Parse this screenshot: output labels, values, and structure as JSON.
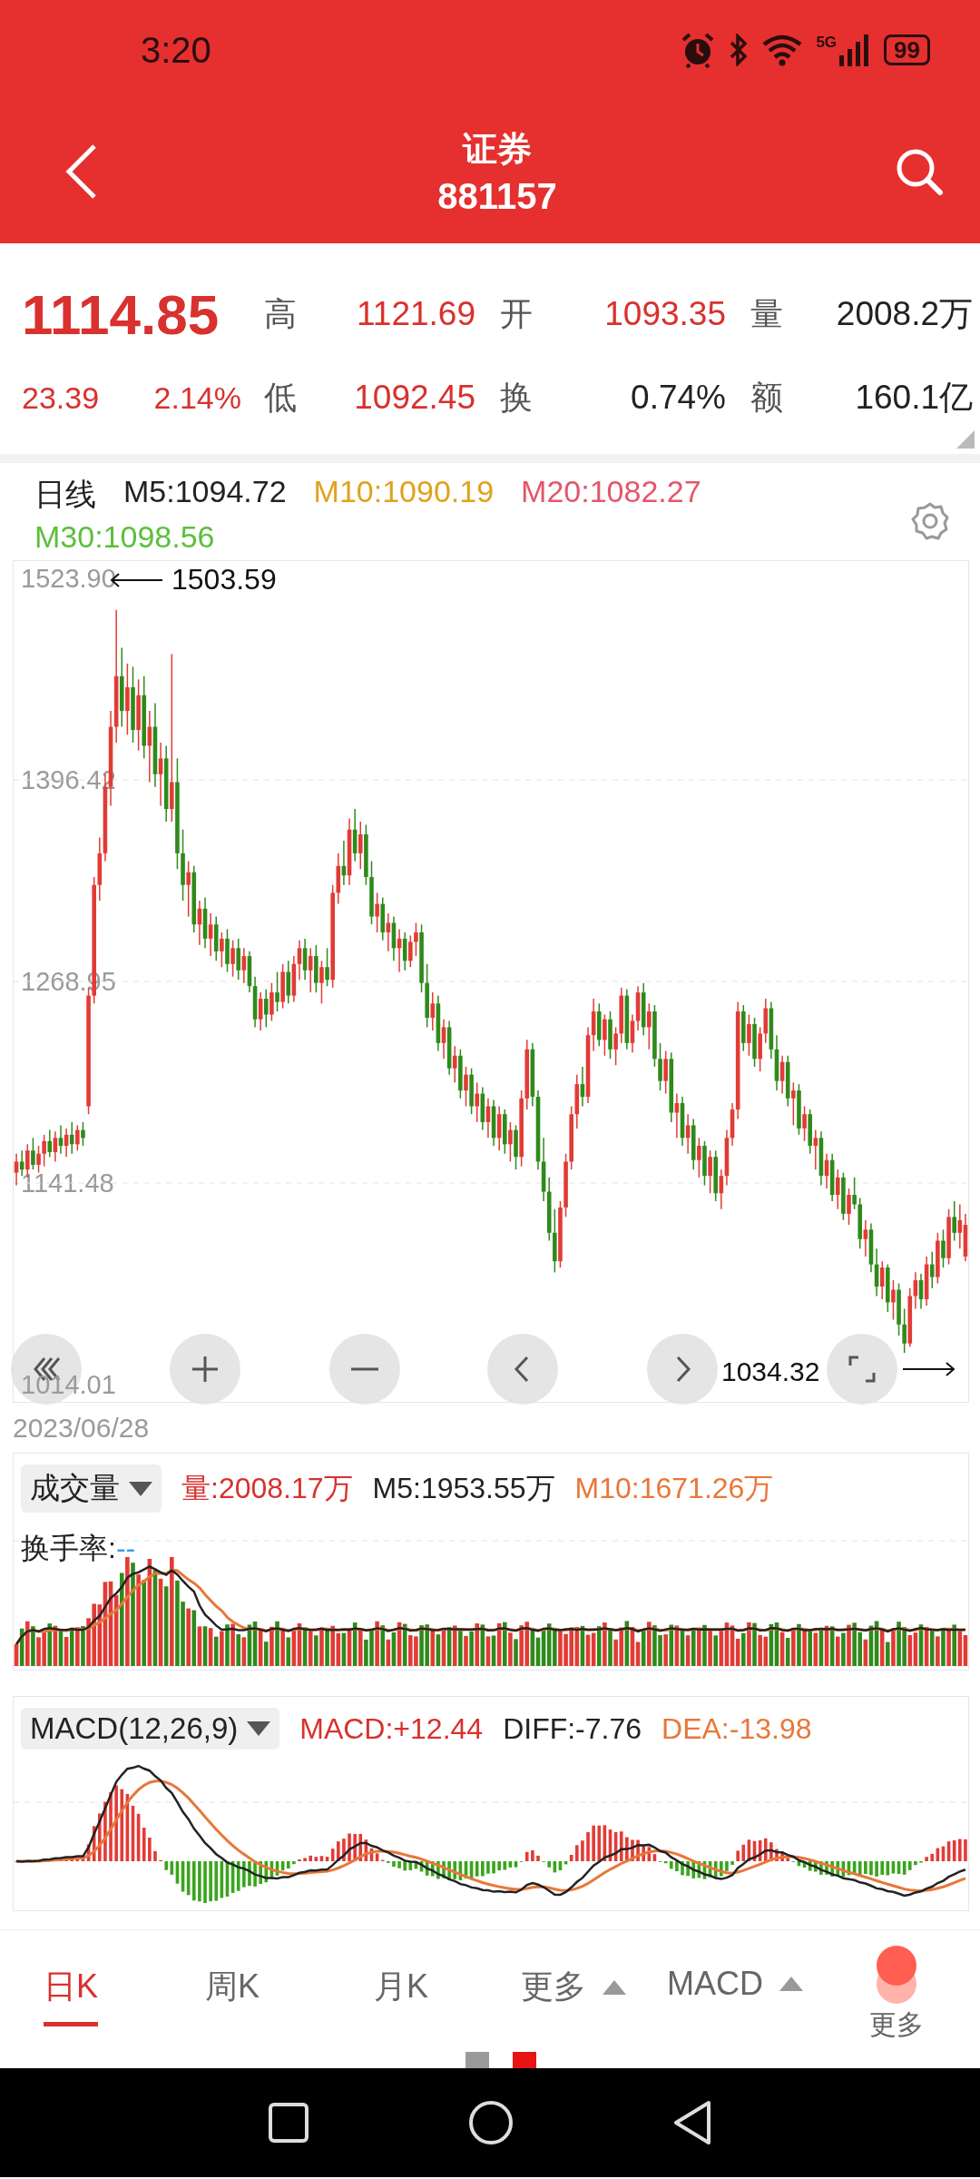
{
  "status_bar": {
    "time": "3:20",
    "network": "5G",
    "battery": "99"
  },
  "header": {
    "title": "证券",
    "code": "881157"
  },
  "quote": {
    "price": "1114.85",
    "change": "23.39",
    "change_pct": "2.14%",
    "stats": [
      {
        "label": "高",
        "value": "1121.69",
        "color": "#d8312e"
      },
      {
        "label": "开",
        "value": "1093.35",
        "color": "#d8312e"
      },
      {
        "label": "量",
        "value": "2008.2万",
        "color": "#222222"
      },
      {
        "label": "低",
        "value": "1092.45",
        "color": "#d8312e"
      },
      {
        "label": "换",
        "value": "0.74%",
        "color": "#222222"
      },
      {
        "label": "额",
        "value": "160.1亿",
        "color": "#222222"
      }
    ]
  },
  "ma_legend": {
    "period": "日线",
    "items": [
      {
        "text": "M5:1094.72",
        "color": "#222222"
      },
      {
        "text": "M10:1090.19",
        "color": "#e0a21c"
      },
      {
        "text": "M20:1082.27",
        "color": "#e4566a"
      },
      {
        "text": "M30:1098.56",
        "color": "#5cbf3c"
      }
    ]
  },
  "price_chart": {
    "high_marker": "1503.59",
    "low_marker": "1034.32",
    "date": "2023/06/28",
    "chart_data": {
      "type": "candlestick",
      "ylim": [
        1003.1,
        1534.8
      ],
      "grid": true,
      "yticks": [
        {
          "value": 1523.9,
          "label": "1523.90"
        },
        {
          "value": 1396.42,
          "label": "1396.42"
        },
        {
          "value": 1268.95,
          "label": "1268.95"
        },
        {
          "value": 1141.48,
          "label": "1141.48"
        },
        {
          "value": 1014.01,
          "label": "1014.01"
        }
      ],
      "ohlc": [
        [
          1148,
          1160,
          1140,
          1155
        ],
        [
          1155,
          1162,
          1146,
          1150
        ],
        [
          1150,
          1166,
          1145,
          1162
        ],
        [
          1162,
          1170,
          1150,
          1153
        ],
        [
          1153,
          1165,
          1148,
          1160
        ],
        [
          1160,
          1172,
          1152,
          1168
        ],
        [
          1168,
          1175,
          1158,
          1161
        ],
        [
          1161,
          1174,
          1155,
          1170
        ],
        [
          1170,
          1178,
          1160,
          1165
        ],
        [
          1165,
          1176,
          1158,
          1172
        ],
        [
          1172,
          1180,
          1160,
          1166
        ],
        [
          1166,
          1178,
          1162,
          1175
        ],
        [
          1175,
          1180,
          1165,
          1170
        ],
        [
          1190,
          1265,
          1185,
          1260
        ],
        [
          1260,
          1335,
          1255,
          1330
        ],
        [
          1330,
          1360,
          1320,
          1350
        ],
        [
          1350,
          1400,
          1345,
          1392
        ],
        [
          1392,
          1440,
          1380,
          1430
        ],
        [
          1430,
          1504,
          1420,
          1462
        ],
        [
          1462,
          1480,
          1430,
          1440
        ],
        [
          1440,
          1470,
          1425,
          1455
        ],
        [
          1455,
          1468,
          1420,
          1428
        ],
        [
          1428,
          1460,
          1415,
          1450
        ],
        [
          1450,
          1462,
          1410,
          1418
        ],
        [
          1418,
          1440,
          1395,
          1430
        ],
        [
          1430,
          1445,
          1392,
          1400
        ],
        [
          1400,
          1420,
          1380,
          1410
        ],
        [
          1410,
          1418,
          1370,
          1378
        ],
        [
          1378,
          1476,
          1370,
          1395
        ],
        [
          1395,
          1410,
          1340,
          1350
        ],
        [
          1350,
          1365,
          1320,
          1330
        ],
        [
          1330,
          1345,
          1310,
          1338
        ],
        [
          1338,
          1342,
          1300,
          1305
        ],
        [
          1305,
          1320,
          1292,
          1315
        ],
        [
          1315,
          1322,
          1290,
          1296
        ],
        [
          1296,
          1312,
          1285,
          1305
        ],
        [
          1305,
          1310,
          1282,
          1288
        ],
        [
          1288,
          1300,
          1278,
          1296
        ],
        [
          1296,
          1302,
          1275,
          1280
        ],
        [
          1280,
          1295,
          1272,
          1290
        ],
        [
          1290,
          1296,
          1270,
          1276
        ],
        [
          1276,
          1290,
          1268,
          1285
        ],
        [
          1285,
          1288,
          1262,
          1266
        ],
        [
          1266,
          1272,
          1240,
          1245
        ],
        [
          1245,
          1262,
          1238,
          1258
        ],
        [
          1258,
          1264,
          1240,
          1248
        ],
        [
          1248,
          1268,
          1244,
          1262
        ],
        [
          1262,
          1275,
          1250,
          1256
        ],
        [
          1256,
          1280,
          1252,
          1275
        ],
        [
          1275,
          1282,
          1255,
          1260
        ],
        [
          1260,
          1285,
          1256,
          1280
        ],
        [
          1280,
          1295,
          1270,
          1290
        ],
        [
          1290,
          1296,
          1270,
          1276
        ],
        [
          1276,
          1290,
          1262,
          1285
        ],
        [
          1285,
          1292,
          1262,
          1268
        ],
        [
          1268,
          1282,
          1255,
          1278
        ],
        [
          1278,
          1290,
          1266,
          1270
        ],
        [
          1270,
          1330,
          1265,
          1325
        ],
        [
          1325,
          1350,
          1318,
          1342
        ],
        [
          1342,
          1358,
          1330,
          1336
        ],
        [
          1336,
          1372,
          1330,
          1365
        ],
        [
          1365,
          1378,
          1345,
          1350
        ],
        [
          1350,
          1370,
          1340,
          1362
        ],
        [
          1362,
          1368,
          1330,
          1335
        ],
        [
          1335,
          1345,
          1305,
          1310
        ],
        [
          1310,
          1325,
          1300,
          1318
        ],
        [
          1318,
          1322,
          1295,
          1300
        ],
        [
          1300,
          1312,
          1288,
          1306
        ],
        [
          1306,
          1310,
          1282,
          1290
        ],
        [
          1290,
          1302,
          1275,
          1296
        ],
        [
          1296,
          1300,
          1276,
          1282
        ],
        [
          1282,
          1298,
          1278,
          1294
        ],
        [
          1294,
          1306,
          1285,
          1300
        ],
        [
          1300,
          1305,
          1262,
          1268
        ],
        [
          1268,
          1280,
          1240,
          1246
        ],
        [
          1246,
          1262,
          1238,
          1255
        ],
        [
          1255,
          1260,
          1225,
          1230
        ],
        [
          1230,
          1245,
          1220,
          1240
        ],
        [
          1240,
          1244,
          1210,
          1214
        ],
        [
          1214,
          1228,
          1205,
          1222
        ],
        [
          1222,
          1226,
          1195,
          1200
        ],
        [
          1200,
          1215,
          1190,
          1210
        ],
        [
          1210,
          1214,
          1185,
          1190
        ],
        [
          1190,
          1205,
          1180,
          1198
        ],
        [
          1198,
          1202,
          1175,
          1180
        ],
        [
          1180,
          1195,
          1170,
          1190
        ],
        [
          1190,
          1194,
          1165,
          1170
        ],
        [
          1170,
          1190,
          1162,
          1185
        ],
        [
          1185,
          1188,
          1160,
          1166
        ],
        [
          1166,
          1180,
          1155,
          1175
        ],
        [
          1175,
          1178,
          1150,
          1158
        ],
        [
          1158,
          1200,
          1152,
          1195
        ],
        [
          1195,
          1232,
          1188,
          1226
        ],
        [
          1226,
          1230,
          1190,
          1196
        ],
        [
          1196,
          1200,
          1150,
          1155
        ],
        [
          1155,
          1170,
          1130,
          1136
        ],
        [
          1136,
          1145,
          1105,
          1110
        ],
        [
          1110,
          1125,
          1085,
          1092
        ],
        [
          1092,
          1130,
          1088,
          1126
        ],
        [
          1126,
          1160,
          1120,
          1155
        ],
        [
          1155,
          1190,
          1150,
          1185
        ],
        [
          1185,
          1210,
          1176,
          1204
        ],
        [
          1204,
          1215,
          1190,
          1196
        ],
        [
          1196,
          1240,
          1192,
          1235
        ],
        [
          1235,
          1258,
          1225,
          1250
        ],
        [
          1250,
          1255,
          1228,
          1232
        ],
        [
          1232,
          1248,
          1222,
          1245
        ],
        [
          1245,
          1250,
          1220,
          1226
        ],
        [
          1226,
          1240,
          1216,
          1236
        ],
        [
          1236,
          1265,
          1230,
          1260
        ],
        [
          1260,
          1264,
          1226,
          1230
        ],
        [
          1230,
          1248,
          1224,
          1244
        ],
        [
          1244,
          1266,
          1238,
          1262
        ],
        [
          1262,
          1268,
          1235,
          1240
        ],
        [
          1240,
          1255,
          1226,
          1250
        ],
        [
          1250,
          1254,
          1215,
          1220
        ],
        [
          1220,
          1230,
          1200,
          1206
        ],
        [
          1206,
          1225,
          1198,
          1220
        ],
        [
          1220,
          1224,
          1180,
          1186
        ],
        [
          1186,
          1198,
          1170,
          1192
        ],
        [
          1192,
          1196,
          1165,
          1170
        ],
        [
          1170,
          1185,
          1160,
          1178
        ],
        [
          1178,
          1182,
          1150,
          1156
        ],
        [
          1156,
          1170,
          1145,
          1165
        ],
        [
          1165,
          1168,
          1140,
          1146
        ],
        [
          1146,
          1162,
          1135,
          1158
        ],
        [
          1158,
          1162,
          1130,
          1135
        ],
        [
          1135,
          1150,
          1125,
          1146
        ],
        [
          1146,
          1175,
          1140,
          1170
        ],
        [
          1170,
          1192,
          1165,
          1188
        ],
        [
          1188,
          1256,
          1182,
          1250
        ],
        [
          1250,
          1254,
          1225,
          1230
        ],
        [
          1230,
          1248,
          1222,
          1242
        ],
        [
          1242,
          1246,
          1215,
          1220
        ],
        [
          1220,
          1240,
          1212,
          1236
        ],
        [
          1236,
          1258,
          1230,
          1252
        ],
        [
          1252,
          1256,
          1220,
          1226
        ],
        [
          1226,
          1235,
          1200,
          1206
        ],
        [
          1206,
          1222,
          1198,
          1218
        ],
        [
          1218,
          1222,
          1190,
          1195
        ],
        [
          1195,
          1205,
          1178,
          1200
        ],
        [
          1200,
          1204,
          1172,
          1176
        ],
        [
          1176,
          1190,
          1168,
          1185
        ],
        [
          1185,
          1188,
          1160,
          1165
        ],
        [
          1165,
          1175,
          1150,
          1170
        ],
        [
          1170,
          1174,
          1140,
          1146
        ],
        [
          1146,
          1160,
          1138,
          1156
        ],
        [
          1156,
          1160,
          1130,
          1134
        ],
        [
          1134,
          1150,
          1125,
          1145
        ],
        [
          1145,
          1148,
          1118,
          1122
        ],
        [
          1122,
          1138,
          1115,
          1134
        ],
        [
          1134,
          1145,
          1125,
          1128
        ],
        [
          1128,
          1132,
          1100,
          1106
        ],
        [
          1106,
          1118,
          1095,
          1112
        ],
        [
          1112,
          1116,
          1085,
          1090
        ],
        [
          1090,
          1100,
          1070,
          1076
        ],
        [
          1076,
          1092,
          1068,
          1088
        ],
        [
          1088,
          1090,
          1060,
          1066
        ],
        [
          1066,
          1080,
          1055,
          1074
        ],
        [
          1074,
          1078,
          1045,
          1052
        ],
        [
          1052,
          1062,
          1034,
          1040
        ],
        [
          1040,
          1075,
          1038,
          1070
        ],
        [
          1070,
          1085,
          1062,
          1080
        ],
        [
          1080,
          1084,
          1062,
          1068
        ],
        [
          1068,
          1095,
          1064,
          1090
        ],
        [
          1090,
          1098,
          1075,
          1082
        ],
        [
          1082,
          1110,
          1078,
          1105
        ],
        [
          1105,
          1112,
          1088,
          1094
        ],
        [
          1094,
          1125,
          1090,
          1120
        ],
        [
          1120,
          1130,
          1105,
          1110
        ],
        [
          1110,
          1128,
          1100,
          1118
        ],
        [
          1095,
          1122,
          1092,
          1115
        ]
      ]
    }
  },
  "volume_panel": {
    "selector": "成交量",
    "legend": [
      {
        "text": "量:2008.17万",
        "color": "#d8312e"
      },
      {
        "text": "M5:1953.55万",
        "color": "#222222"
      },
      {
        "text": "M10:1671.26万",
        "color": "#e8773a"
      }
    ],
    "turnover_label": "换手率:",
    "turnover_value": "--"
  },
  "macd_panel": {
    "selector": "MACD(12,26,9)",
    "legend": [
      {
        "text": "MACD:+12.44",
        "color": "#d8312e"
      },
      {
        "text": "DIFF:-7.76",
        "color": "#222222"
      },
      {
        "text": "DEA:-13.98",
        "color": "#e8773a"
      }
    ]
  },
  "bottom_tabs": [
    {
      "label": "日K",
      "selected": true
    },
    {
      "label": "周K",
      "selected": false
    },
    {
      "label": "月K",
      "selected": false
    },
    {
      "label": "更多",
      "selected": false
    }
  ],
  "indicator": {
    "label": "MACD"
  },
  "more": {
    "label": "更多"
  },
  "page_dots": [
    {
      "selected": false
    },
    {
      "selected": true
    }
  ]
}
